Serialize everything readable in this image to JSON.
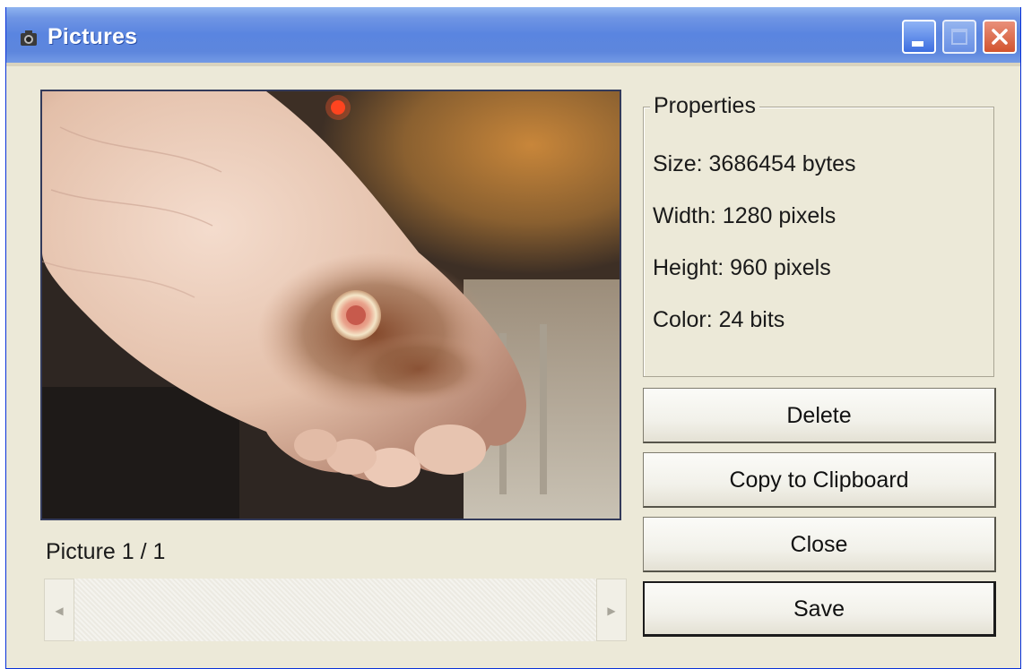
{
  "window": {
    "title": "Pictures",
    "icon": "camera-icon"
  },
  "titlebar_buttons": {
    "minimize_icon": "minimize-icon",
    "maximize_icon": "maximize-icon",
    "close_icon": "close-icon"
  },
  "viewer": {
    "counter": "Picture 1 / 1"
  },
  "properties": {
    "legend": "Properties",
    "size": "Size: 3686454 bytes",
    "width": "Width: 1280 pixels",
    "height": "Height: 960 pixels",
    "color": "Color: 24 bits"
  },
  "actions": {
    "delete_label": "Delete",
    "copy_label": "Copy to Clipboard",
    "close_label": "Close",
    "save_label": "Save"
  },
  "colors": {
    "titlebar": "#5a85e0",
    "window_face": "#ece9d8",
    "close_button": "#d2542f"
  }
}
